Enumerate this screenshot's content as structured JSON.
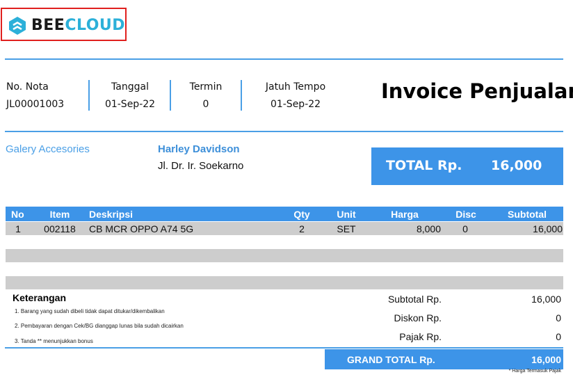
{
  "brand": {
    "part1": "BEE",
    "part2": "CLOUD",
    "color_dark": "#1a1a1a",
    "color_accent": "#2cb0d9",
    "icon": "beecloud-logo-icon"
  },
  "colors": {
    "accent": "#3d94e8",
    "highlight_border": "#e0201e",
    "row_bg": "#cdcdcd"
  },
  "meta": {
    "no_nota_label": "No. Nota",
    "no_nota_value": "JL00001003",
    "tanggal_label": "Tanggal",
    "tanggal_value": "01-Sep-22",
    "termin_label": "Termin",
    "termin_value": "0",
    "jatuh_tempo_label": "Jatuh Tempo",
    "jatuh_tempo_value": "01-Sep-22"
  },
  "title": "Invoice Penjualan",
  "company_name": "Galery Accesories",
  "customer": {
    "name": "Harley Davidson",
    "address": "Jl. Dr. Ir. Soekarno"
  },
  "total": {
    "label": "TOTAL Rp.",
    "value": "16,000"
  },
  "table": {
    "headers": {
      "no": "No",
      "item": "Item",
      "deskripsi": "Deskripsi",
      "qty": "Qty",
      "unit": "Unit",
      "harga": "Harga",
      "disc": "Disc",
      "subtotal": "Subtotal"
    },
    "rows": [
      {
        "no": "1",
        "item": "002118",
        "deskripsi": "CB MCR OPPO A74 5G",
        "qty": "2",
        "unit": "SET",
        "harga": "8,000",
        "disc": "0",
        "subtotal": "16,000"
      }
    ]
  },
  "keterangan": {
    "title": "Keterangan",
    "notes": [
      "1. Barang yang sudah dibeli tidak dapat ditukar/dikembalikan",
      "2. Pembayaran dengan Cek/BG dianggap lunas bila sudah dicairkan",
      "3. Tanda ** menunjukkan bonus"
    ]
  },
  "summary": {
    "subtotal_label": "Subtotal Rp.",
    "subtotal_value": "16,000",
    "diskon_label": "Diskon Rp.",
    "diskon_value": "0",
    "pajak_label": "Pajak Rp.",
    "pajak_value": "0",
    "grand_label": "GRAND TOTAL Rp.",
    "grand_value": "16,000"
  },
  "footnote": "* Harga Termasuk Pajak"
}
